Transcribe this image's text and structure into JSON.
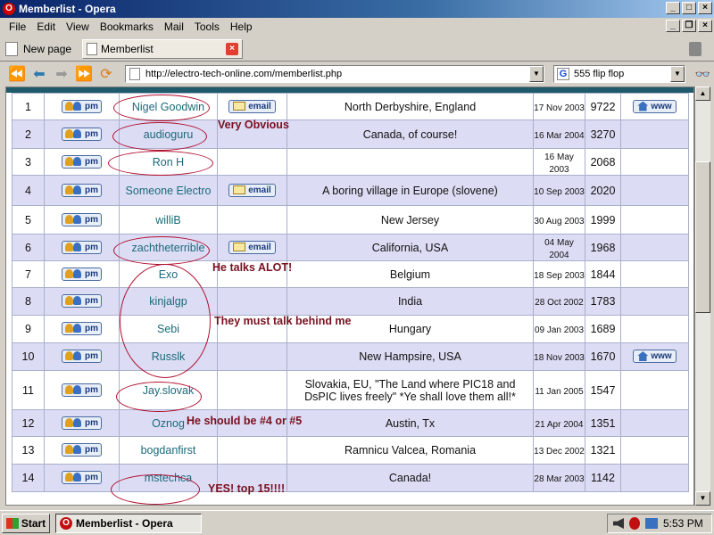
{
  "window": {
    "title": "Memberlist - Opera",
    "app_icon": "opera-icon"
  },
  "menu": [
    "File",
    "Edit",
    "View",
    "Bookmarks",
    "Mail",
    "Tools",
    "Help"
  ],
  "tabs": {
    "new_page_label": "New page",
    "active_tab": "Memberlist"
  },
  "nav": {
    "url": "http://electro-tech-online.com/memberlist.php",
    "search_value": "555 flip flop",
    "search_engine_icon": "G"
  },
  "table": {
    "rows": [
      {
        "rank": "1",
        "name": "Nigel Goodwin",
        "email": true,
        "location": "North Derbyshire, England",
        "date": "17 Nov 2003",
        "posts": "9722",
        "www": true
      },
      {
        "rank": "2",
        "name": "audioguru",
        "email": false,
        "location": "Canada, of course!",
        "date": "16 Mar 2004",
        "posts": "3270",
        "www": false
      },
      {
        "rank": "3",
        "name": "Ron H",
        "email": false,
        "location": "",
        "date": "16 May 2003",
        "posts": "2068",
        "www": false
      },
      {
        "rank": "4",
        "name": "Someone Electro",
        "email": true,
        "location": "A boring village in Europe (slovene)",
        "date": "10 Sep 2003",
        "posts": "2020",
        "www": false
      },
      {
        "rank": "5",
        "name": "williB",
        "email": false,
        "location": "New Jersey",
        "date": "30 Aug 2003",
        "posts": "1999",
        "www": false
      },
      {
        "rank": "6",
        "name": "zachtheterrible",
        "email": true,
        "location": "California, USA",
        "date": "04 May 2004",
        "posts": "1968",
        "www": false
      },
      {
        "rank": "7",
        "name": "Exo",
        "email": false,
        "location": "Belgium",
        "date": "18 Sep 2003",
        "posts": "1844",
        "www": false
      },
      {
        "rank": "8",
        "name": "kinjalgp",
        "email": false,
        "location": "India",
        "date": "28 Oct 2002",
        "posts": "1783",
        "www": false
      },
      {
        "rank": "9",
        "name": "Sebi",
        "email": false,
        "location": "Hungary",
        "date": "09 Jan 2003",
        "posts": "1689",
        "www": false
      },
      {
        "rank": "10",
        "name": "Russlk",
        "email": false,
        "location": "New Hampsire, USA",
        "date": "18 Nov 2003",
        "posts": "1670",
        "www": true
      },
      {
        "rank": "11",
        "name": "Jay.slovak",
        "email": false,
        "location": "Slovakia, EU, \"The Land where PIC18 and DsPIC lives freely\" *Ye shall love them all!*",
        "date": "11 Jan 2005",
        "posts": "1547",
        "www": false
      },
      {
        "rank": "12",
        "name": "Oznog",
        "email": false,
        "location": "Austin, Tx",
        "date": "21 Apr 2004",
        "posts": "1351",
        "www": false
      },
      {
        "rank": "13",
        "name": "bogdanfirst",
        "email": false,
        "location": "Ramnicu Valcea, Romania",
        "date": "13 Dec 2002",
        "posts": "1321",
        "www": false
      },
      {
        "rank": "14",
        "name": "mstechca",
        "email": false,
        "location": "Canada!",
        "date": "28 Mar 2003",
        "posts": "1142",
        "www": false
      }
    ],
    "pm_label": "pm",
    "email_label": "email",
    "www_label": "www"
  },
  "annotations": [
    {
      "id": "annot-very-obvious",
      "text": "Very Obvious"
    },
    {
      "id": "annot-talks-alot",
      "text": "He talks ALOT!"
    },
    {
      "id": "annot-talk-behind",
      "text": "They must talk behind me"
    },
    {
      "id": "annot-should-be",
      "text": "He should be #4 or #5"
    },
    {
      "id": "annot-top15",
      "text": "YES! top 15!!!!"
    }
  ],
  "colors": {
    "annotation": "#7a1020",
    "username": "#1a6a7a",
    "alt_row": "#dcdcf4"
  },
  "taskbar": {
    "start_label": "Start",
    "task_label": "Memberlist - Opera",
    "clock": "5:53 PM"
  }
}
